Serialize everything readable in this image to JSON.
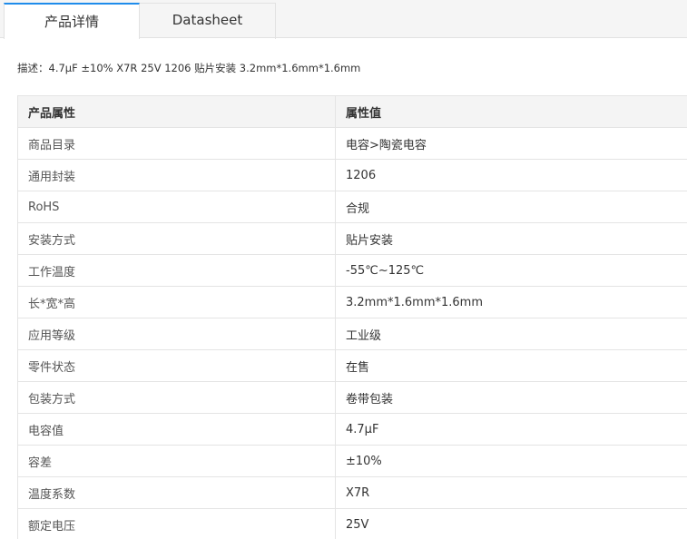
{
  "tabs": [
    {
      "label": "产品详情",
      "active": true
    },
    {
      "label": "Datasheet",
      "active": false
    }
  ],
  "description": "描述：4.7μF ±10% X7R 25V 1206 贴片安装 3.2mm*1.6mm*1.6mm",
  "table": {
    "headers": [
      "产品属性",
      "属性值"
    ],
    "rows": [
      [
        "商品目录",
        "电容>陶瓷电容"
      ],
      [
        "通用封装",
        "1206"
      ],
      [
        "RoHS",
        "合规"
      ],
      [
        "安装方式",
        "贴片安装"
      ],
      [
        "工作温度",
        "-55℃~125℃"
      ],
      [
        "长*宽*高",
        "3.2mm*1.6mm*1.6mm"
      ],
      [
        "应用等级",
        "工业级"
      ],
      [
        "零件状态",
        "在售"
      ],
      [
        "包装方式",
        "卷带包装"
      ],
      [
        "电容值",
        "4.7μF"
      ],
      [
        "容差",
        "±10%"
      ],
      [
        "温度系数",
        "X7R"
      ],
      [
        "额定电压",
        "25V"
      ]
    ]
  },
  "colors": {
    "accent": "#1f8ceb",
    "header_bg": "#f4f4f4",
    "border": "#e4e4e4"
  }
}
